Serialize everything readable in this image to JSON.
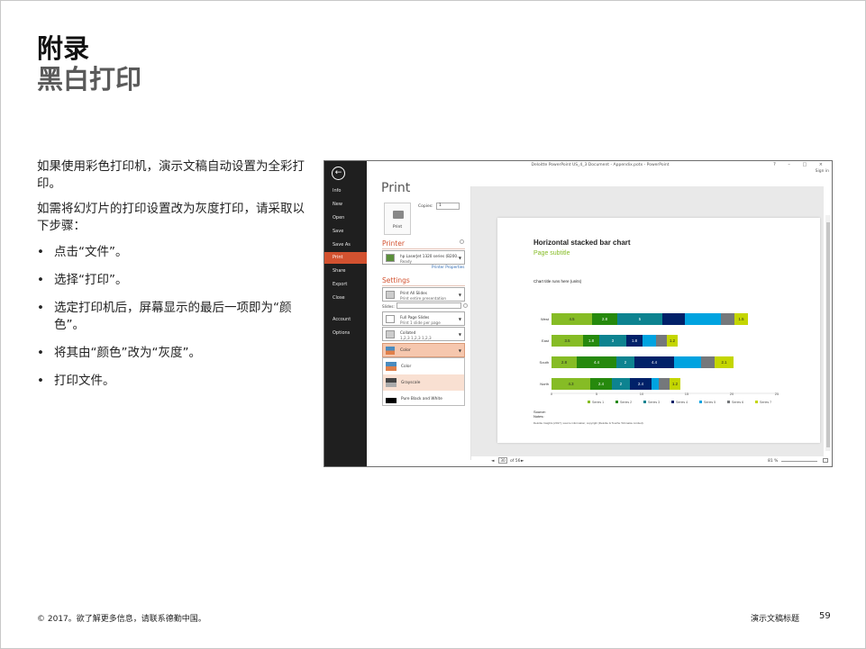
{
  "slide": {
    "title": "附录",
    "subtitle": "黑白打印",
    "intro1": "如果使用彩色打印机，演示文稿自动设置为全彩打印。",
    "intro2": "如需将幻灯片的打印设置改为灰度打印，请采取以下步骤：",
    "bullets": [
      "点击“文件”。",
      "选择“打印”。",
      "选定打印机后，屏幕显示的最后一项即为“颜色”。",
      "将其由“颜色”改为“灰度”。",
      "打印文件。"
    ],
    "footer_left": "© 2017。欲了解更多信息，请联系德勤中国。",
    "footer_right": "演示文稿标题",
    "page_number": "59"
  },
  "screenshot": {
    "window_title": "Deloitte PowerPoint US_4_3 Document - Appendix.potx - PowerPoint",
    "window_controls": "?  –  □  ×",
    "sign_in": "Sign in",
    "back_icon": "back-arrow-icon",
    "backstage": [
      "Info",
      "New",
      "Open",
      "Save",
      "Save As",
      "Print",
      "Share",
      "Export",
      "Close",
      "Account",
      "Options"
    ],
    "active_item": "Print",
    "print_heading": "Print",
    "print_button": "Print",
    "copies_label": "Copies:",
    "copies_value": "1",
    "printer_label": "Printer",
    "printer_name": "hp LaserJet 1320 series (B200...",
    "printer_status": "Ready",
    "printer_properties": "Printer Properties",
    "settings_label": "Settings",
    "setting1_t1": "Print All Slides",
    "setting1_t2": "Print entire presentation",
    "slides_label": "Slides:",
    "setting2_t1": "Full Page Slides",
    "setting2_t2": "Print 1 slide per page",
    "setting3_t1": "Collated",
    "setting3_t2": "1,2,3   1,2,3   1,2,3",
    "color_selected": "Color",
    "color_options": [
      "Color",
      "Grayscale",
      "Pure Black and White"
    ],
    "page_current": "30",
    "page_total": "of 56",
    "zoom": "81 %",
    "colors": {
      "accent": "#d35230",
      "backstage": "#1f1f1f"
    }
  },
  "chart_data": {
    "type": "bar",
    "orientation": "horizontal-stacked",
    "title": "Horizontal stacked bar chart",
    "subtitle": "Page subtitle",
    "chart_title": "Chart title runs here (units)",
    "categories": [
      "West",
      "East",
      "South",
      "North"
    ],
    "xticks": [
      "0",
      "5",
      "10",
      "15",
      "20",
      "25"
    ],
    "xlim": [
      0,
      25
    ],
    "series": [
      {
        "name": "Series 1",
        "color": "#86bc25",
        "values": [
          4.5,
          3.5,
          2.8,
          4.3
        ]
      },
      {
        "name": "Series 2",
        "color": "#26890d",
        "values": [
          2.8,
          1.8,
          4.4,
          2.4
        ]
      },
      {
        "name": "Series 3",
        "color": "#0d8390",
        "values": [
          5.0,
          3.0,
          2.0,
          2.0
        ]
      },
      {
        "name": "Series 4",
        "color": "#012169",
        "values": [
          2.5,
          1.8,
          4.4,
          2.4
        ]
      },
      {
        "name": "Series 5",
        "color": "#00a3e0",
        "values": [
          4.0,
          1.5,
          3.0,
          0.8
        ]
      },
      {
        "name": "Series 6",
        "color": "#75787b",
        "values": [
          1.5,
          1.2,
          1.5,
          1.2
        ]
      },
      {
        "name": "Series 7",
        "color": "#c4d600",
        "values": [
          1.5,
          1.2,
          2.1,
          1.2
        ]
      }
    ],
    "label_values": [
      [
        "4.5",
        "2.8",
        "5",
        "",
        "",
        "",
        "1.5"
      ],
      [
        "3.5",
        "1.8",
        "3",
        "1.8",
        "",
        "",
        "1.2"
      ],
      [
        "2.8",
        "4.4",
        "2",
        "4.4",
        "",
        "",
        "2.1"
      ],
      [
        "4.3",
        "2.4",
        "2",
        "2.4",
        "",
        "",
        "1.2"
      ]
    ],
    "legend_position": "bottom",
    "source_label": "Source:",
    "notes_label": "Notes:",
    "source_line": "Deloitte Insights (2017); source information; copyright (Deloitte & Touche Tohmatsu Limited)."
  }
}
